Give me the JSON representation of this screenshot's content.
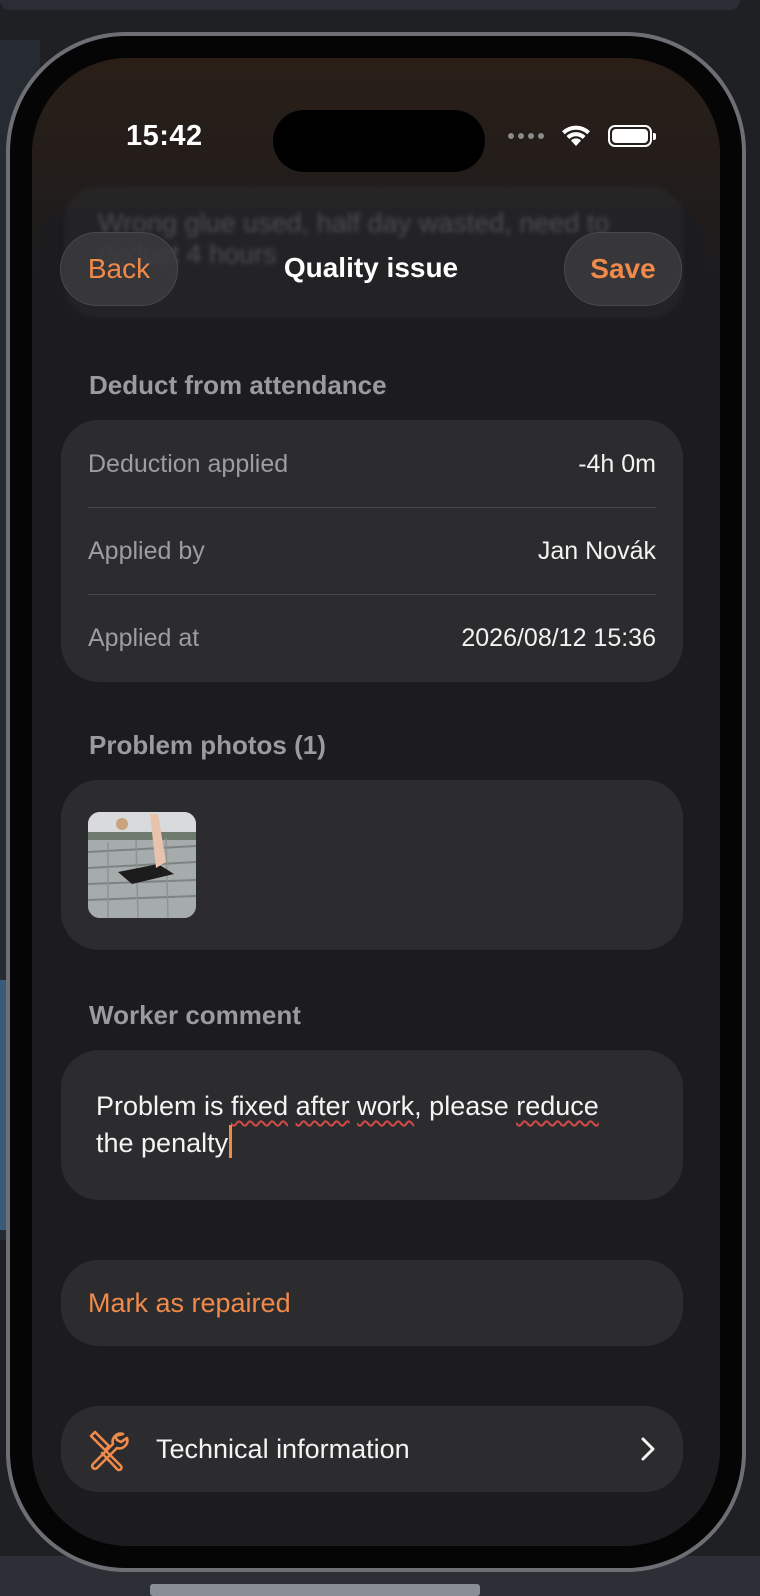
{
  "status_bar": {
    "time": "15:42"
  },
  "nav": {
    "back_label": "Back",
    "title": "Quality issue",
    "save_label": "Save"
  },
  "behind_card_text": "Wrong glue used, half day wasted, need to deduct 4 hours",
  "deduction": {
    "section_title": "Deduct from attendance",
    "rows": [
      {
        "label": "Deduction applied",
        "value": "-4h 0m"
      },
      {
        "label": "Applied by",
        "value": "Jan Novák"
      },
      {
        "label": "Applied at",
        "value": "2026/08/12 15:36"
      }
    ]
  },
  "photos": {
    "section_title": "Problem photos (1)"
  },
  "comment": {
    "section_title": "Worker comment",
    "text_parts": {
      "p1": "Problem is ",
      "w1": "fixed",
      "p2": " ",
      "w2": "after",
      "p3": " ",
      "w3": "work",
      "p4": ", please ",
      "w4": "reduce",
      "p5": " the penalty"
    }
  },
  "repair": {
    "label": "Mark as repaired"
  },
  "technical": {
    "label": "Technical information",
    "icon": "tools-icon"
  },
  "colors": {
    "accent": "#f08a4b",
    "background": "#1c1c1e",
    "card": "#2c2c2e"
  }
}
